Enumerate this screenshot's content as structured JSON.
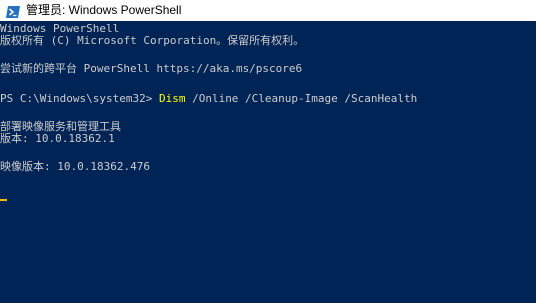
{
  "window": {
    "title": "管理员: Windows PowerShell",
    "icon": "powershell-icon"
  },
  "console": {
    "lines": [
      "Windows PowerShell",
      "版权所有 (C) Microsoft Corporation。保留所有权利。",
      "尝试新的跨平台 PowerShell https://aka.ms/pscore6"
    ],
    "prompt": "PS C:\\Windows\\system32> ",
    "command": "Dism",
    "command_args": " /Online /Cleanup-Image /ScanHealth",
    "output": [
      "部署映像服务和管理工具",
      "版本: 10.0.18362.1",
      "映像版本: 10.0.18362.476"
    ]
  },
  "colors": {
    "background": "#012456",
    "text": "#cccccc",
    "command": "#ffff00",
    "cursor": "#f0c000"
  }
}
